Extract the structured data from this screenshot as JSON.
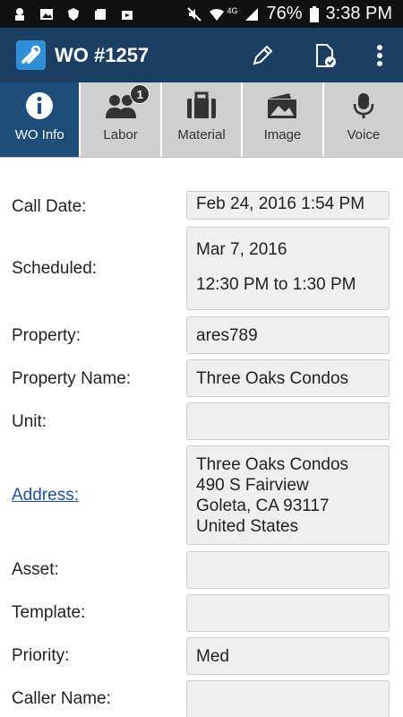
{
  "status_bar": {
    "battery": "76%",
    "time": "3:38 PM",
    "network": "4G"
  },
  "app_bar": {
    "title": "WO #1257"
  },
  "tabs": [
    {
      "label": "WO Info",
      "active": true
    },
    {
      "label": "Labor",
      "badge": "1"
    },
    {
      "label": "Material"
    },
    {
      "label": "Image"
    },
    {
      "label": "Voice"
    }
  ],
  "fields": {
    "call_date": {
      "label": "Call Date:",
      "value": "Feb 24, 2016 1:54 PM"
    },
    "scheduled": {
      "label": "Scheduled:",
      "date": "Mar 7, 2016",
      "time": "12:30 PM to 1:30 PM"
    },
    "property": {
      "label": "Property:",
      "value": "ares789"
    },
    "property_name": {
      "label": "Property Name:",
      "value": "Three Oaks Condos"
    },
    "unit": {
      "label": "Unit:",
      "value": ""
    },
    "address": {
      "label": "Address:",
      "line1": "Three Oaks Condos",
      "line2": "490 S Fairview",
      "line3": "Goleta, CA 93117",
      "line4": "United States"
    },
    "asset": {
      "label": "Asset:",
      "value": ""
    },
    "template": {
      "label": "Template:",
      "value": ""
    },
    "priority": {
      "label": "Priority:",
      "value": "Med"
    },
    "caller_name": {
      "label": "Caller Name:",
      "value": ""
    }
  },
  "colors": {
    "app_bar": "#1b3f63",
    "active_tab": "#1d4d78",
    "link": "#1a4fa3"
  }
}
